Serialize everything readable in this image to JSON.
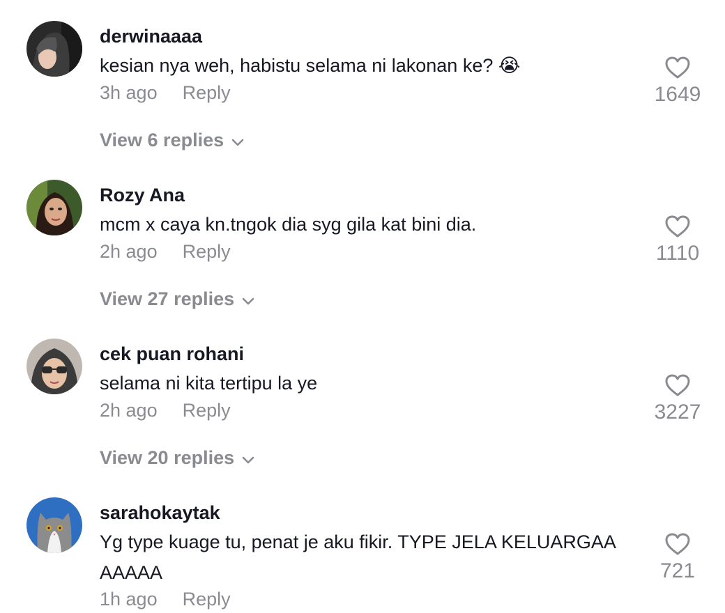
{
  "comments": [
    {
      "username": "derwinaaaa",
      "text": "kesian nya weh, habistu selama ni lakonan ke? 😭",
      "time": "3h ago",
      "reply_label": "Reply",
      "likes": "1649",
      "view_replies": "View 6 replies"
    },
    {
      "username": "Rozy Ana",
      "text": "mcm x caya kn.tngok dia syg gila kat bini dia.",
      "time": "2h ago",
      "reply_label": "Reply",
      "likes": "1110",
      "view_replies": "View 27 replies"
    },
    {
      "username": "cek puan rohani",
      "text": "selama ni kita tertipu la ye",
      "time": "2h ago",
      "reply_label": "Reply",
      "likes": "3227",
      "view_replies": "View 20 replies"
    },
    {
      "username": "sarahokaytak",
      "text": "Yg type kuage tu, penat je aku fikir. TYPE JELA KELUARGAA AAAAA",
      "time": "1h ago",
      "reply_label": "Reply",
      "likes": "721"
    }
  ],
  "colors": {
    "primary_text": "#161823",
    "secondary_text": "#8a8b91",
    "background": "#ffffff"
  },
  "icons": {
    "like": "heart-outline-icon",
    "expand": "chevron-down-icon"
  }
}
